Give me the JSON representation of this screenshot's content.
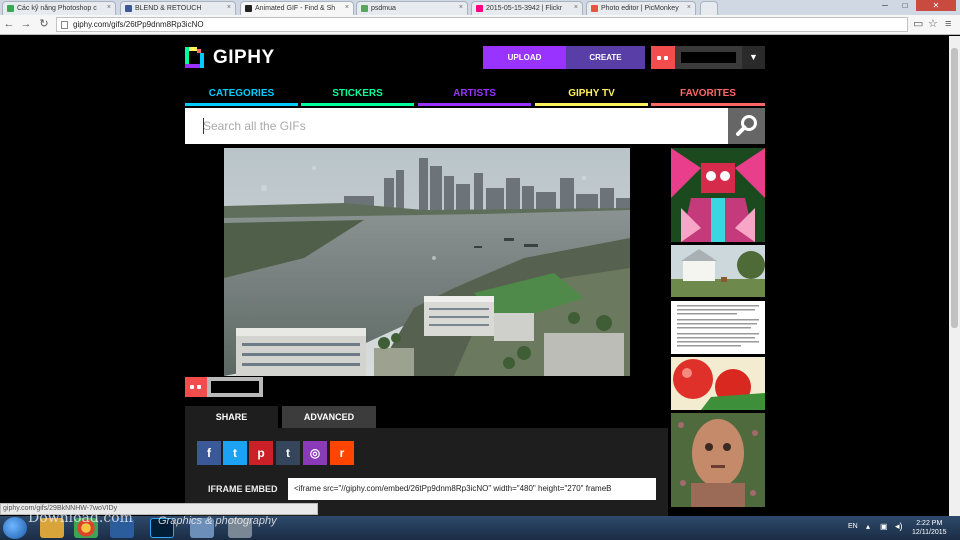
{
  "browser": {
    "tabs": [
      {
        "label": "Các kỹ năng Photoshop c",
        "color": "#3aa757",
        "active": false
      },
      {
        "label": "BLEND & RETOUCH",
        "color": "#3b5998",
        "active": false
      },
      {
        "label": "Animated GIF - Find & Sh",
        "color": "#222222",
        "active": true
      },
      {
        "label": "psdmua",
        "color": "#58a55c",
        "active": false
      },
      {
        "label": "2015-05-15-3942 | Flickr",
        "color": "#ff0084",
        "active": false
      },
      {
        "label": "Photo editor | PicMonkey",
        "color": "#e8543f",
        "active": false
      }
    ],
    "url": "giphy.com/gifs/26tPp9dnm8Rp3icNO"
  },
  "giphy": {
    "logo": "GIPHY",
    "upload_label": "UPLOAD",
    "create_label": "CREATE",
    "nav": [
      {
        "label": "CATEGORIES",
        "color": "#00ccff"
      },
      {
        "label": "STICKERS",
        "color": "#00ff99"
      },
      {
        "label": "ARTISTS",
        "color": "#9933ff"
      },
      {
        "label": "GIPHY TV",
        "color": "#fff35c"
      },
      {
        "label": "FAVORITES",
        "color": "#ff6666"
      }
    ],
    "search_placeholder": "Search all the GIFs",
    "share_tab": "SHARE",
    "advanced_tab": "ADVANCED",
    "social": [
      {
        "glyph": "f",
        "color": "#3b5998",
        "name": "facebook-icon"
      },
      {
        "glyph": "t",
        "color": "#1da1f2",
        "name": "twitter-icon"
      },
      {
        "glyph": "p",
        "color": "#cb2027",
        "name": "pinterest-icon"
      },
      {
        "glyph": "t",
        "color": "#35465c",
        "name": "tumblr-icon"
      },
      {
        "glyph": "◎",
        "color": "#8a3ab9",
        "name": "instagram-icon"
      },
      {
        "glyph": "r",
        "color": "#ff4500",
        "name": "reddit-icon"
      }
    ],
    "iframe_label": "IFRAME EMBED",
    "embed_code": "<iframe src=\"//giphy.com/embed/26tPp9dnm8Rp3icNO\" width=\"480\" height=\"270\" frameB"
  },
  "status_url": "giphy.com/gifs/29BkNNHW-7woVIDy",
  "watermark": "Download.com",
  "watermark_sub": "Graphics & photography",
  "taskbar": {
    "lang": "EN",
    "time": "2:22 PM",
    "date": "12/11/2015"
  }
}
